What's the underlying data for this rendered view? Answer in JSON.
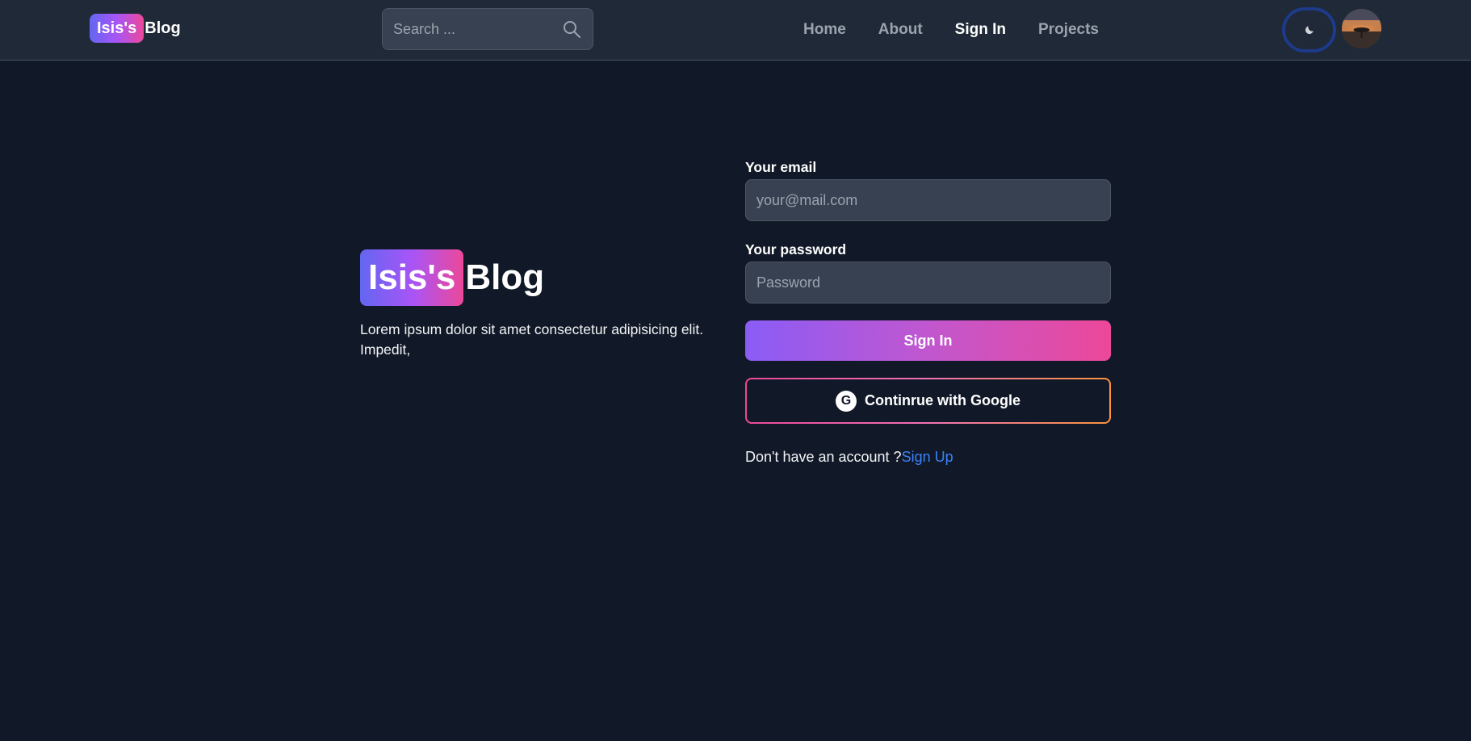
{
  "navbar": {
    "logo_badge": "Isis's",
    "logo_rest": "Blog",
    "search_placeholder": "Search ...",
    "search_icon": "search-icon",
    "links": [
      {
        "label": "Home",
        "active": false
      },
      {
        "label": "About",
        "active": false
      },
      {
        "label": "Sign In",
        "active": true
      },
      {
        "label": "Projects",
        "active": false
      }
    ],
    "theme_icon": "moon-icon",
    "avatar_icon": "avatar-image"
  },
  "hero": {
    "logo_badge": "Isis's",
    "logo_rest": "Blog",
    "description": "Lorem ipsum dolor sit amet consectetur adipisicing elit. Impedit,"
  },
  "form": {
    "email_label": "Your email",
    "email_placeholder": "your@mail.com",
    "password_label": "Your password",
    "password_placeholder": "Password",
    "signin_label": "Sign In",
    "google_label": "Continrue with Google",
    "google_icon_letter": "G",
    "signup_prompt": "Don't have an account ?",
    "signup_link": "Sign Up"
  },
  "colors": {
    "background": "#111827",
    "navbar": "#1f2937",
    "input": "#374151",
    "link": "#3b82f6",
    "gradient_start": "#6366f1",
    "gradient_end": "#ec4899"
  }
}
